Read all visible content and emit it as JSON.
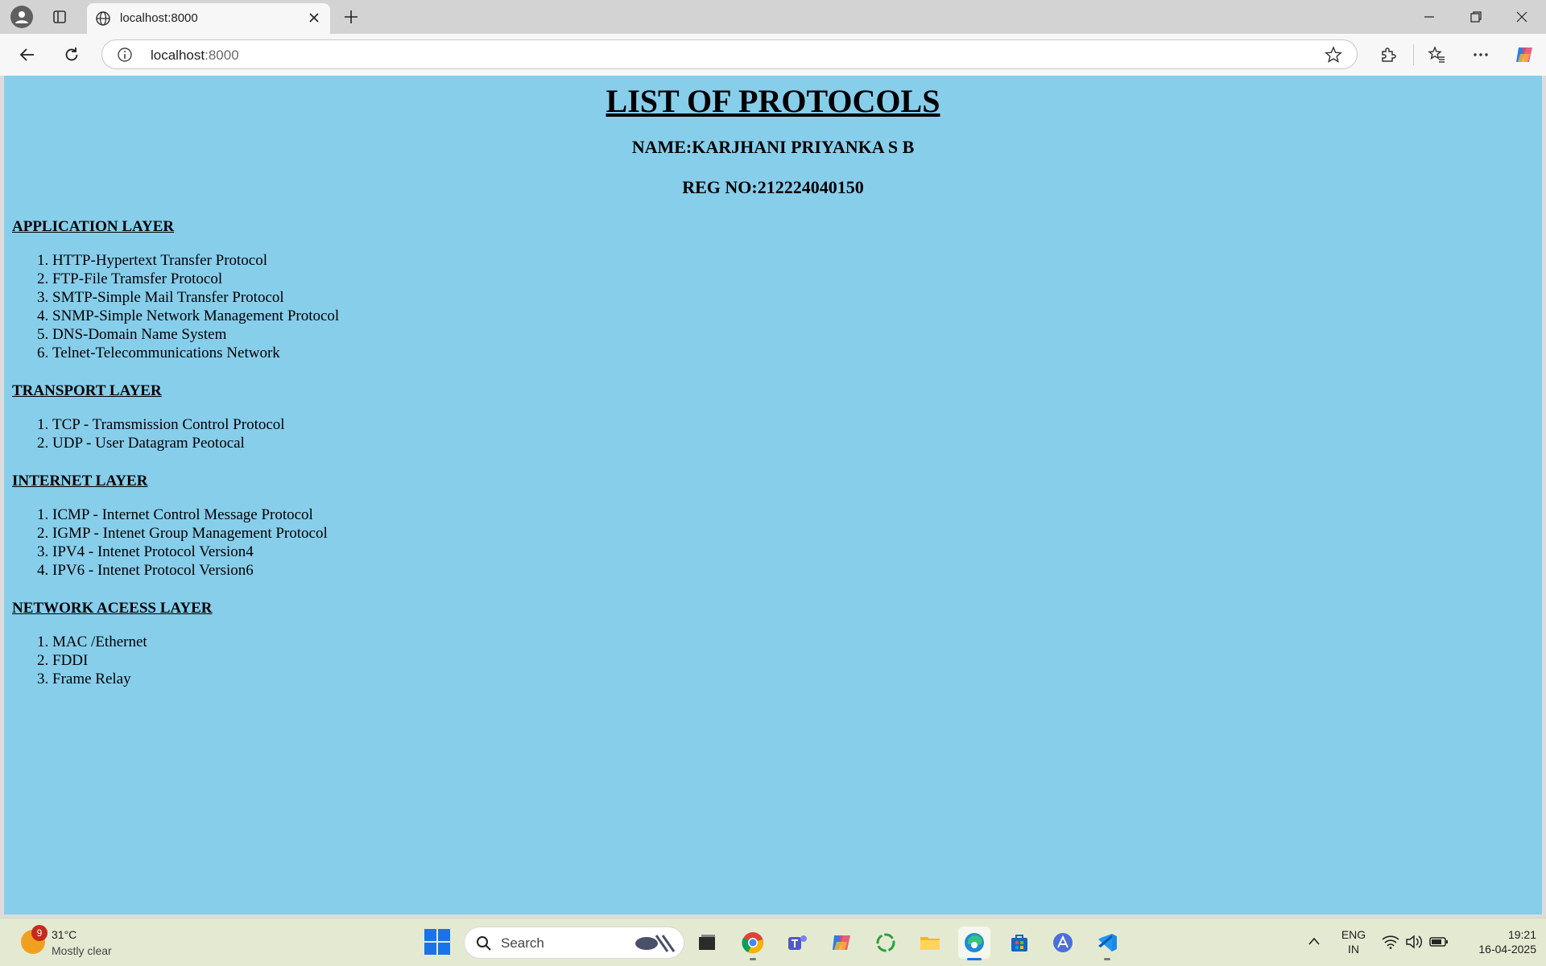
{
  "browser": {
    "tab_title": "localhost:8000",
    "url_host": "localhost",
    "url_port": ":8000"
  },
  "page": {
    "title": "LIST OF PROTOCOLS",
    "name": "NAME:KARJHANI PRIYANKA S B",
    "reg_no": "REG NO:212224040150",
    "sections": [
      {
        "heading": "APPLICATION LAYER",
        "items": [
          "HTTP-Hypertext Transfer Protocol",
          "FTP-File Tramsfer Protocol",
          "SMTP-Simple Mail Transfer Protocol",
          "SNMP-Simple Network Management Protocol",
          "DNS-Domain Name System",
          "Telnet-Telecommunications Network"
        ]
      },
      {
        "heading": "TRANSPORT LAYER",
        "items": [
          "TCP - Tramsmission Control Protocol",
          "UDP - User Datagram Peotocal"
        ]
      },
      {
        "heading": "INTERNET LAYER",
        "items": [
          "ICMP - Internet Control Message Protocol",
          "IGMP - Intenet Group Management Protocol",
          "IPV4 - Intenet Protocol Version4",
          "IPV6 - Intenet Protocol Version6"
        ]
      },
      {
        "heading": "NETWORK ACEESS LAYER",
        "items": [
          "MAC /Ethernet",
          "FDDI",
          "Frame Relay"
        ]
      }
    ],
    "background_color": "#87ceeb"
  },
  "taskbar": {
    "weather_badge": "9",
    "temperature": "31°C",
    "condition": "Mostly clear",
    "search_label": "Search",
    "lang_1": "ENG",
    "lang_2": "IN",
    "time": "19:21",
    "date": "16-04-2025",
    "apps": [
      "start-icon",
      "file-manager-icon",
      "chrome-icon",
      "teams-icon",
      "copilot-icon",
      "refresh-app-icon",
      "file-explorer-icon",
      "edge-icon",
      "store-icon",
      "app-icon",
      "vscode-icon"
    ]
  }
}
